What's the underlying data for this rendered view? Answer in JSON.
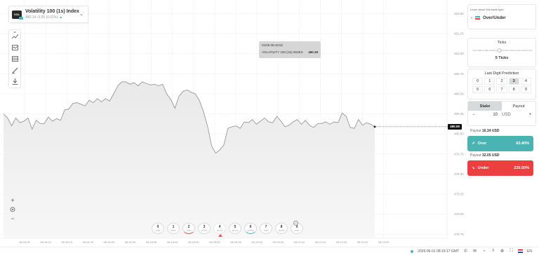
{
  "symbol": {
    "icon_label": "VOL",
    "name": "Volatility 100 (1s) Index",
    "price": "480.14",
    "change": "-0.05 (0.01%)"
  },
  "toolbar": {
    "items": [
      {
        "name": "chart-type-icon",
        "label": "1T"
      },
      {
        "name": "indicators-icon",
        "label": ""
      },
      {
        "name": "templates-icon",
        "label": ""
      },
      {
        "name": "drawing-tools-icon",
        "label": ""
      },
      {
        "name": "download-icon",
        "label": ""
      }
    ]
  },
  "tooltip": {
    "datetime": "01/06 08:18:52",
    "label": "VOLATILITY 100 (1S) INDEX",
    "value": "480.39"
  },
  "current_price": "480.09",
  "y_axis": {
    "ticks": [
      "481.50",
      "481.25",
      "481.00",
      "480.75",
      "480.50",
      "480.25",
      "480.00",
      "479.75",
      "479.50",
      "479.25",
      "479.00",
      "478.75"
    ]
  },
  "x_axis": {
    "ticks": [
      "08:18:05",
      "08:18:10",
      "08:18:15",
      "08:18:20",
      "08:18:25",
      "08:18:30",
      "08:18:35",
      "08:18:40",
      "08:18:45",
      "08:18:50",
      "08:18:55",
      "08:19:00",
      "08:19:05",
      "08:19:10",
      "08:19:15",
      "08:19:20",
      "08:19:25",
      "08:19:30"
    ]
  },
  "chart_data": {
    "type": "area",
    "title": "",
    "xlabel": "",
    "ylabel": "",
    "ylim": [
      478.75,
      481.5
    ],
    "series": [
      {
        "values": [
          480.25,
          480.2,
          480.1,
          480.2,
          480.14,
          480.16,
          480.2,
          480.06,
          480.17,
          480.13,
          480.13,
          480.21,
          480.16,
          480.19,
          480.17,
          480.3,
          480.31,
          480.38,
          480.39,
          480.37,
          480.35,
          480.42,
          480.39,
          480.44,
          480.4,
          480.44,
          480.41,
          480.5,
          480.6,
          480.65,
          480.65,
          480.62,
          480.64,
          480.6,
          480.65,
          480.63,
          480.61,
          480.62,
          480.6,
          480.62,
          480.5,
          480.43,
          480.32,
          480.47,
          480.53,
          480.55,
          480.52,
          480.5,
          480.42,
          480.28,
          480.1,
          479.85,
          479.76,
          479.8,
          479.86,
          480.07,
          480.09,
          480.1,
          480.07,
          480.15,
          480.14,
          480.18,
          480.12,
          480.16,
          480.2,
          480.15,
          480.14,
          480.22,
          480.16,
          480.09,
          480.11,
          480.15,
          480.18,
          480.12,
          480.17,
          480.11,
          480.08,
          480.13,
          480.13,
          480.15,
          480.12,
          480.15,
          480.14,
          480.26,
          480.22,
          480.08,
          480.07,
          480.18,
          480.11,
          480.14,
          480.12,
          480.09
        ]
      }
    ]
  },
  "digit_stats": [
    {
      "digit": "0",
      "pct": "9.6%",
      "mark": "none"
    },
    {
      "digit": "1",
      "pct": "8.6%",
      "mark": "none"
    },
    {
      "digit": "2",
      "pct": "8.2%",
      "mark": "red"
    },
    {
      "digit": "3",
      "pct": "10.6%",
      "mark": "none"
    },
    {
      "digit": "4",
      "pct": "10.4%",
      "mark": "none"
    },
    {
      "digit": "5",
      "pct": "10.7%",
      "mark": "none"
    },
    {
      "digit": "6",
      "pct": "12.5%",
      "mark": "green"
    },
    {
      "digit": "7",
      "pct": "9.9%",
      "mark": "none"
    },
    {
      "digit": "8",
      "pct": "10.0%",
      "mark": "none"
    },
    {
      "digit": "9",
      "pct": "9.9%",
      "mark": "none"
    }
  ],
  "current_digit_index": 4,
  "panel": {
    "learn_text": "Learn about this trade type",
    "trade_type": "Over/Under",
    "ticks_title": "Ticks",
    "ticks_value": "5 Ticks",
    "ticks_steps": 10,
    "ticks_selected_index": 4,
    "last_digit_title": "Last Digit Prediction",
    "digits": [
      "0",
      "1",
      "2",
      "3",
      "4",
      "5",
      "6",
      "7",
      "8",
      "9"
    ],
    "selected_digit": "3",
    "stake_tab": "Stake",
    "payout_tab": "Payout",
    "stake_minus": "−",
    "stake_plus": "+",
    "stake_amount": "10",
    "currency": "USD",
    "over": {
      "payout_label": "Payout",
      "payout_value": "16.34 USD",
      "label": "Over",
      "pct": "63.40%"
    },
    "under": {
      "payout_label": "Payout",
      "payout_value": "32.05 USD",
      "label": "Under",
      "pct": "220.50%"
    }
  },
  "statusbar": {
    "left_text": "",
    "datetime": "2025-06-01 08:19:17 GMT",
    "language": "EN"
  },
  "colors": {
    "accent_green": "#4bb4b3",
    "accent_red": "#ec3f3f",
    "line": "#999999"
  }
}
